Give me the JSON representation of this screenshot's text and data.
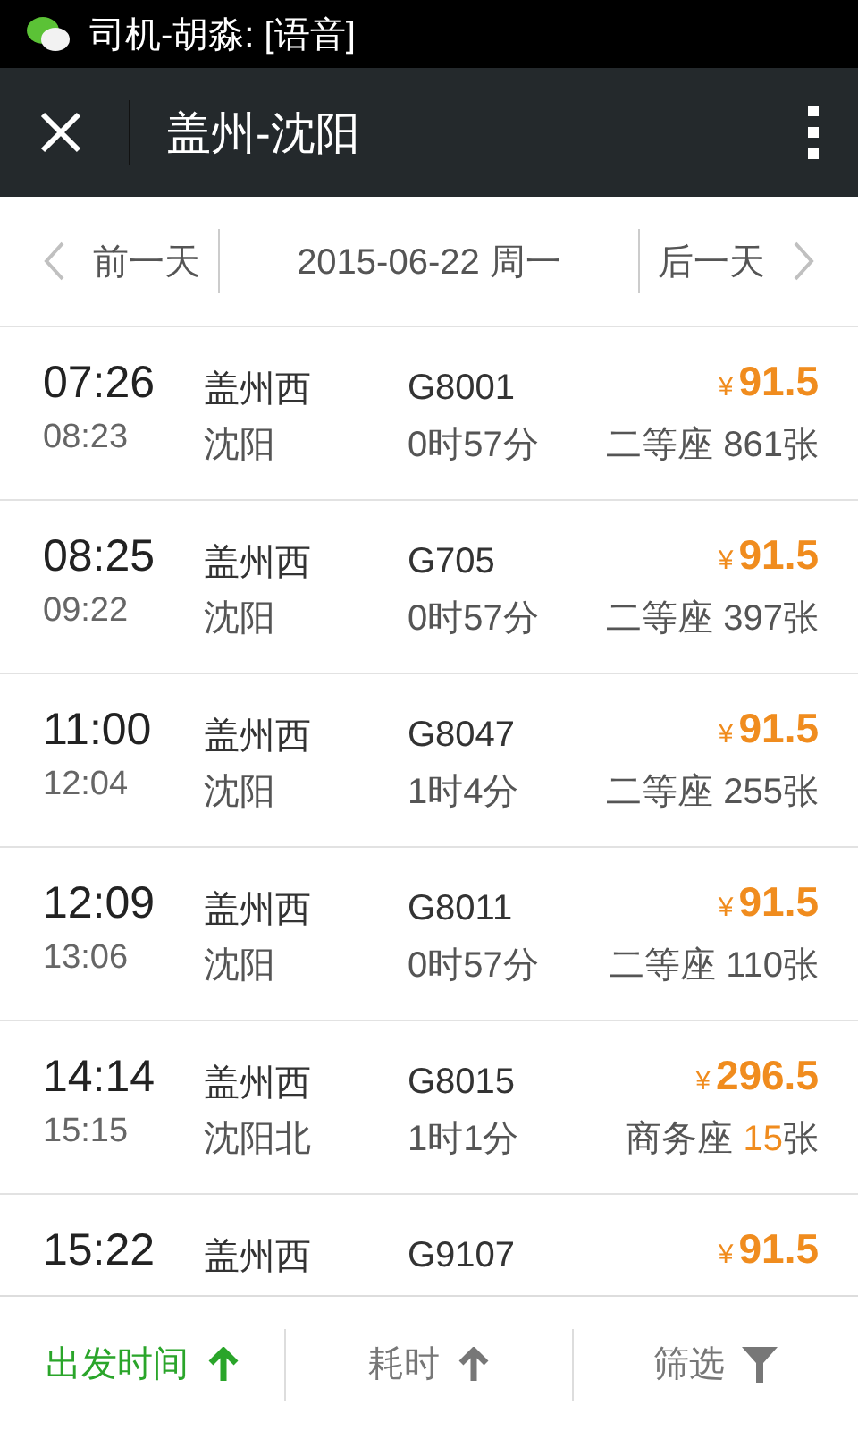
{
  "status_bar": {
    "notification": "司机-胡淼: [语音]"
  },
  "header": {
    "title": "盖州-沈阳"
  },
  "date_bar": {
    "prev": "前一天",
    "date": "2015-06-22 周一",
    "next": "后一天"
  },
  "trains": [
    {
      "dep_time": "07:26",
      "arr_time": "08:23",
      "from": "盖州西",
      "to": "沈阳",
      "train": "G8001",
      "duration": "0时57分",
      "currency": "¥",
      "price": "91.5",
      "seat_class": "二等座",
      "seat_count": "861",
      "seat_unit": "张",
      "scarce": false
    },
    {
      "dep_time": "08:25",
      "arr_time": "09:22",
      "from": "盖州西",
      "to": "沈阳",
      "train": "G705",
      "duration": "0时57分",
      "currency": "¥",
      "price": "91.5",
      "seat_class": "二等座",
      "seat_count": "397",
      "seat_unit": "张",
      "scarce": false
    },
    {
      "dep_time": "11:00",
      "arr_time": "12:04",
      "from": "盖州西",
      "to": "沈阳",
      "train": "G8047",
      "duration": "1时4分",
      "currency": "¥",
      "price": "91.5",
      "seat_class": "二等座",
      "seat_count": "255",
      "seat_unit": "张",
      "scarce": false
    },
    {
      "dep_time": "12:09",
      "arr_time": "13:06",
      "from": "盖州西",
      "to": "沈阳",
      "train": "G8011",
      "duration": "0时57分",
      "currency": "¥",
      "price": "91.5",
      "seat_class": "二等座",
      "seat_count": "110",
      "seat_unit": "张",
      "scarce": false
    },
    {
      "dep_time": "14:14",
      "arr_time": "15:15",
      "from": "盖州西",
      "to": "沈阳北",
      "train": "G8015",
      "duration": "1时1分",
      "currency": "¥",
      "price": "296.5",
      "seat_class": "商务座",
      "seat_count": "15",
      "seat_unit": "张",
      "scarce": true
    },
    {
      "dep_time": "15:22",
      "from": "盖州西",
      "train": "G9107",
      "currency": "¥",
      "price": "91.5"
    }
  ],
  "bottom_bar": [
    {
      "label": "出发时间",
      "kind": "sort",
      "selected": true
    },
    {
      "label": "耗时",
      "kind": "sort",
      "selected": false
    },
    {
      "label": "筛选",
      "kind": "filter",
      "selected": false
    }
  ]
}
